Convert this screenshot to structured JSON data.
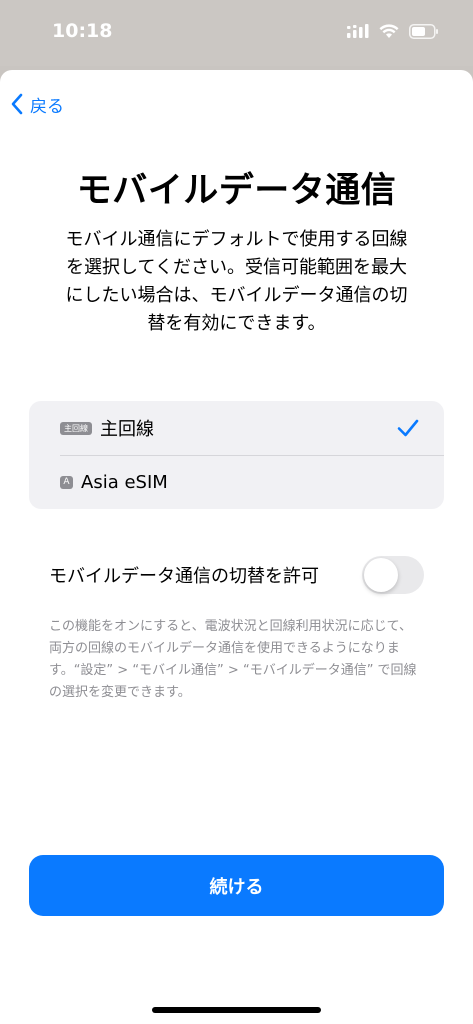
{
  "status_bar": {
    "time": "10:18",
    "icons": [
      "signal-icon",
      "wifi-icon",
      "battery-icon"
    ]
  },
  "nav": {
    "back_label": "戻る"
  },
  "title": "モバイルデータ通信",
  "description": "モバイル通信にデフォルトで使用する回線を選択してください。受信可能範囲を最大にしたい場合は、モバイルデータ通信の切替を有効にできます。",
  "sim_options": [
    {
      "badge": "主回線",
      "label": "主回線",
      "selected": true
    },
    {
      "badge": "A",
      "label": "Asia eSIM",
      "selected": false
    }
  ],
  "switching": {
    "label": "モバイルデータ通信の切替を許可",
    "enabled": false
  },
  "footnote": "この機能をオンにすると、電波状況と回線利用状況に応じて、両方の回線のモバイルデータ通信を使用できるようになります。“設定” > “モバイル通信” > “モバイルデータ通信” で回線の選択を変更できます。",
  "continue_label": "続ける",
  "colors": {
    "accent": "#0a7aff",
    "toggle_off": "#e9e9eb",
    "secondary_text": "#8e8e93"
  }
}
